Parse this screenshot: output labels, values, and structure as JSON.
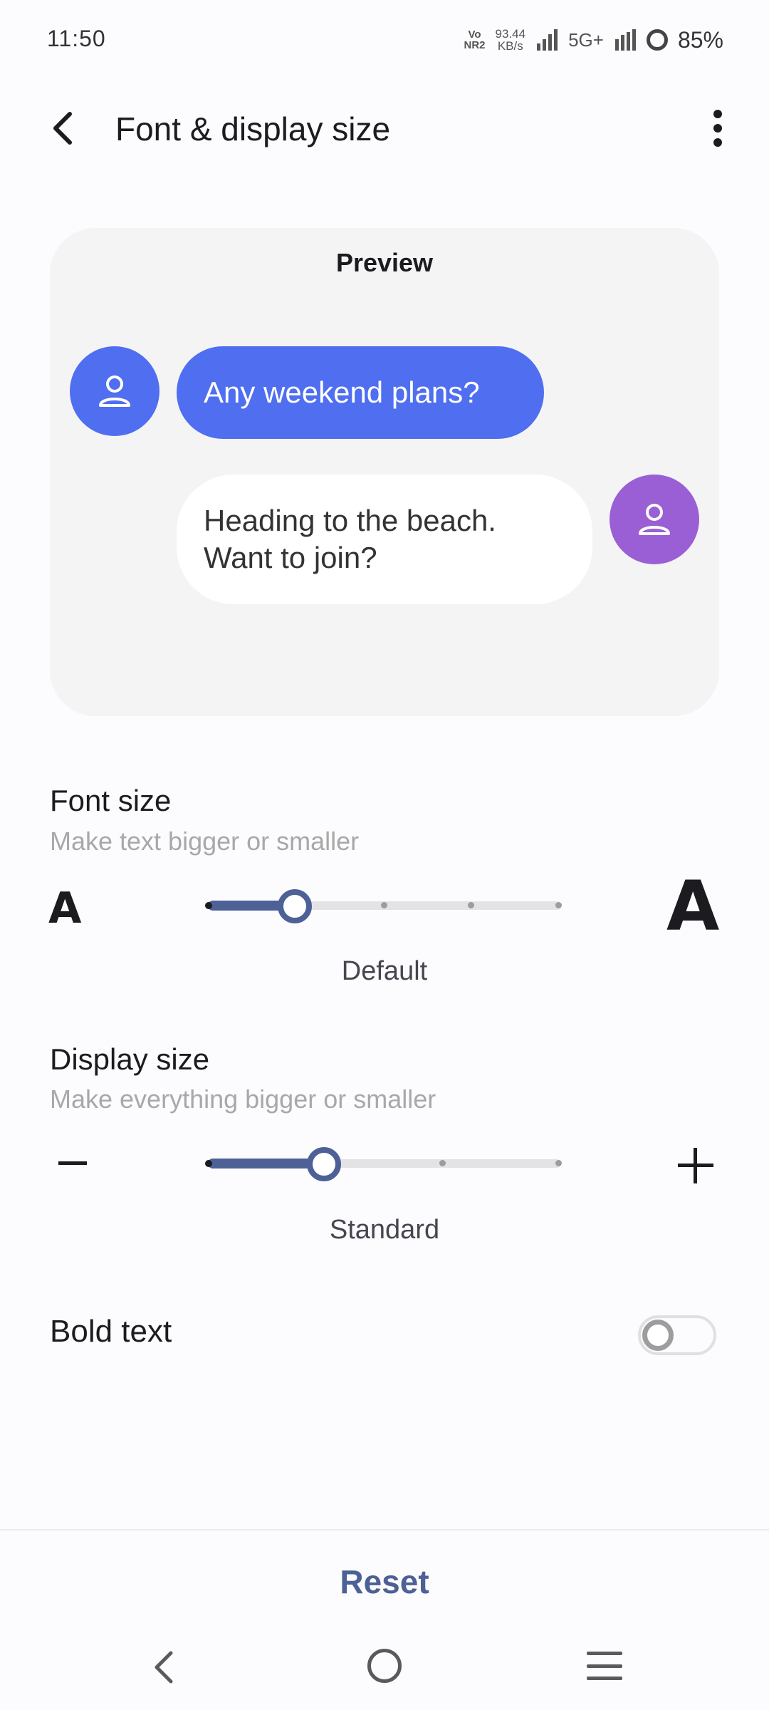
{
  "status_bar": {
    "time": "11:50",
    "volte_top": "Vo",
    "volte_bottom": "NR2",
    "net_speed_value": "93.44",
    "net_speed_unit": "KB/s",
    "network_type": "5G+",
    "battery": "85%"
  },
  "app_bar": {
    "title": "Font & display size",
    "back_icon": "arrow-back-icon",
    "more_icon": "more-vert-icon"
  },
  "preview": {
    "title": "Preview",
    "incoming_message": "Any weekend plans?",
    "outgoing_message_line1": "Heading to the beach.",
    "outgoing_message_line2": "Want to join?",
    "incoming_avatar_color": "#4f6ef0",
    "outgoing_avatar_color": "#9a5fd4"
  },
  "font_size": {
    "title": "Font size",
    "subtitle": "Make text bigger or smaller",
    "small_glyph": "A",
    "large_glyph": "A",
    "value_label": "Default",
    "steps": 5,
    "selected_step": 1
  },
  "display_size": {
    "title": "Display size",
    "subtitle": "Make everything bigger or smaller",
    "value_label": "Standard",
    "steps": 4,
    "selected_step": 1
  },
  "bold_text": {
    "label": "Bold text",
    "enabled": false
  },
  "footer": {
    "reset_label": "Reset"
  },
  "colors": {
    "accent": "#4d6196",
    "bubble_blue": "#4f6ef0",
    "background": "#fcfbfe"
  }
}
